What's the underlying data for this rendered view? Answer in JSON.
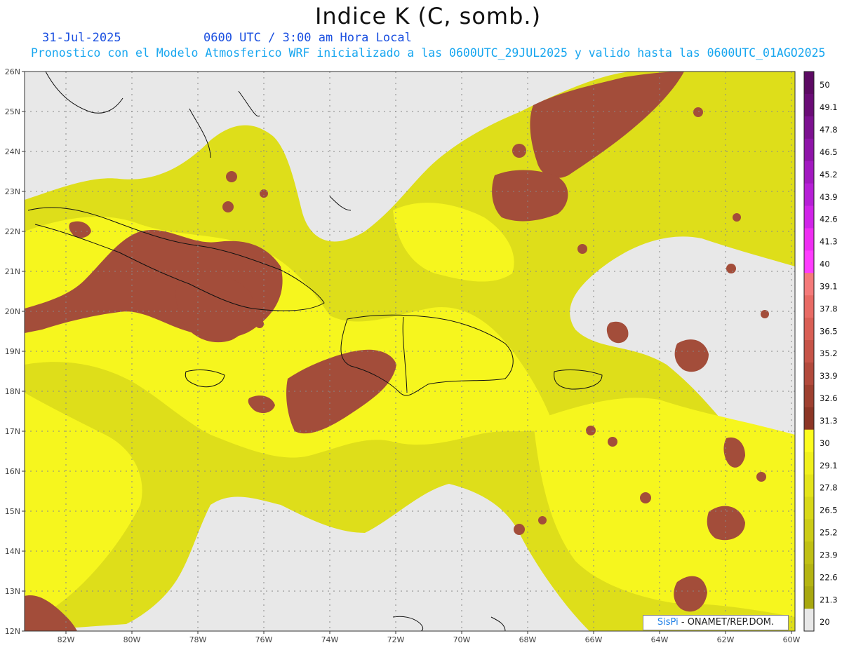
{
  "title": "Indice K (C, somb.)",
  "header": {
    "date": "31-Jul-2025",
    "time": "0600 UTC / 3:00 am Hora Local",
    "model_line": "Pronostico con el Modelo Atmosferico WRF inicializado a las 0600UTC_29JUL2025 y valido hasta las  0600UTC_01AGO2025"
  },
  "map": {
    "lat_labels": [
      "26N",
      "25N",
      "24N",
      "23N",
      "22N",
      "21N",
      "20N",
      "19N",
      "18N",
      "17N",
      "16N",
      "15N",
      "14N",
      "13N",
      "12N"
    ],
    "lon_labels": [
      "82W",
      "80W",
      "78W",
      "76W",
      "74W",
      "72W",
      "70W",
      "68W",
      "66W",
      "64W",
      "62W",
      "60W"
    ]
  },
  "colorbar": {
    "labels": [
      "50",
      "49.1",
      "47.8",
      "46.5",
      "45.2",
      "43.9",
      "42.6",
      "41.3",
      "40",
      "39.1",
      "37.8",
      "36.5",
      "35.2",
      "33.9",
      "32.6",
      "31.3",
      "30",
      "29.1",
      "27.8",
      "26.5",
      "25.2",
      "23.9",
      "22.6",
      "21.3",
      "20"
    ],
    "colors": [
      "#5c0a63",
      "#6a0c76",
      "#7c1190",
      "#8e14a8",
      "#a219c0",
      "#b61fd6",
      "#d024e8",
      "#ee2ef2",
      "#ff3cff",
      "#f47a7a",
      "#e86b65",
      "#d95f55",
      "#c65448",
      "#b24a3c",
      "#9e4030",
      "#8c3626",
      "#fcfc1e",
      "#f0f01c",
      "#e4e41a",
      "#d8d818",
      "#cccc16",
      "#c0c014",
      "#b4b412",
      "#a8a810",
      "#e8e8e8"
    ]
  },
  "credit": {
    "brand": "SisPi",
    "org": " - ONAMET/REP.DOM."
  }
}
